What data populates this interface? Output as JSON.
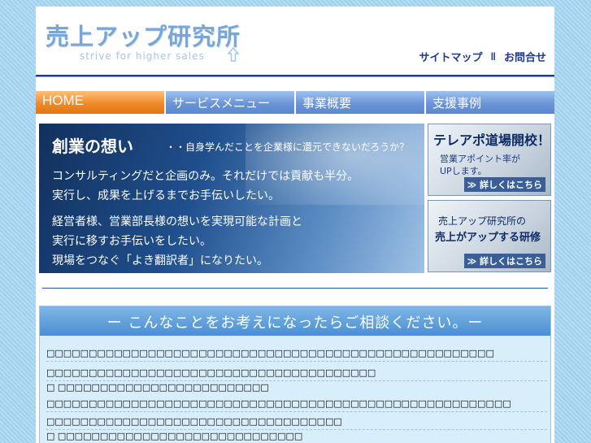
{
  "header": {
    "logo_title": "売上アップ研究所",
    "tagline": "strive for higher sales",
    "links": {
      "sitemap": "サイトマップ",
      "separator": "‖",
      "contact": "お問合せ"
    }
  },
  "nav": {
    "items": [
      {
        "label": "HOME"
      },
      {
        "label": "サービスメニュー"
      },
      {
        "label": "事業概要"
      },
      {
        "label": "支援事例"
      }
    ]
  },
  "hero": {
    "title": "創業の想い",
    "subtitle": "・・自身学んだことを企業様に還元できないだろうか？",
    "lines": [
      "コンサルティングだと企画のみ。それだけでは貢献も半分。",
      "実行し、成果を上げるまでお手伝いしたい。",
      "経営者様、営業部長様の想いを実現可能な計画と",
      "実行に移すお手伝いをしたい。",
      "現場をつなぐ「よき翻訳者」になりたい。"
    ]
  },
  "banners": [
    {
      "title": "テレアポ道場開校！",
      "body1": "営業アポイント率が",
      "body2": "UPします。",
      "more": "≫ 詳しくはこちら"
    },
    {
      "title": "売上アップ研究所の",
      "body1": "売上がアップする研修",
      "more": "≫ 詳しくはこちら"
    }
  ],
  "consult": {
    "heading": "ー こんなことをお考えになったらご相談ください。ー",
    "rows": [
      "□□□□□□□□□□□□□□□□□□□□□□□□□□□□□□□□□□□□□□□□□□□□□□□□□□□□□",
      "□□□□□□□□□□□□□□□□□□□□□□□□□□□□□□□□□□□□□□□",
      "□ □□□□□□□□□□□□□□□□□□□□□□□□□",
      "□□□□□□□□□□□□□□□□□□□□□□□□□□□□□□□□□□□□□□□□□□□□□□□□□□□□□□□",
      "□□□□□□□□□□□□□□□□□□□□□□□□□□□□□□□□□□□",
      "□ □□□□□□□□□□□□□□□□□□□□□□□□□□□□□",
      "□□□□□□□□□□□□□□□□□□□□□□□□□□□□□□□□□□□□□□□□□□□□□□□"
    ]
  }
}
